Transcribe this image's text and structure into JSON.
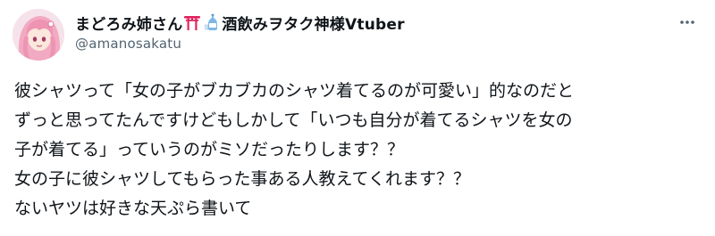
{
  "author": {
    "display_name_part1": "まどろみ姉さん",
    "display_name_part2": "酒飲みヲタク神様Vtuber",
    "handle": "@amanosakatu",
    "avatar_icon": "avatar-anime-girl",
    "name_emoji_1": "torii-gate-icon",
    "name_emoji_2": "sake-bottle-icon"
  },
  "menu": {
    "more_icon": "more-horizontal-icon"
  },
  "tweet": {
    "lines": [
      "彼シャツって「女の子がブカブカのシャツ着てるのが可愛い」的なのだと",
      "ずっと思ってたんですけどもしかして「いつも自分が着てるシャツを女の",
      "子が着てる」っていうのがミソだったりします？？",
      "女の子に彼シャツしてもらった事ある人教えてくれます？？",
      "ないヤツは好きな天ぷら書いて"
    ]
  },
  "colors": {
    "text_primary": "#0f1419",
    "text_secondary": "#536471",
    "background": "#ffffff",
    "torii_red": "#e0245e"
  }
}
